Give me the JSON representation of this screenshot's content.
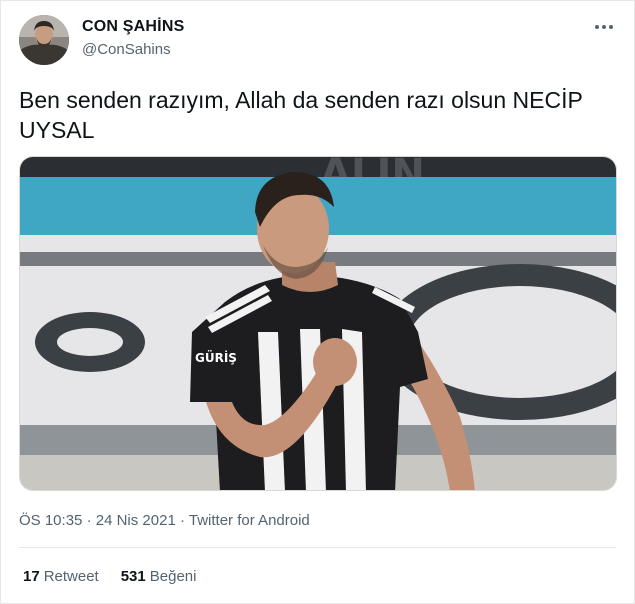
{
  "author": {
    "display_name": "CON ŞAHİNS",
    "handle": "@ConSahins"
  },
  "more_icon": "more-dots-icon",
  "tweet": {
    "text": "Ben senden razıyım, Allah da senden razı olsun NECİP UYSAL"
  },
  "media": {
    "jersey_sponsor": "GÜRİŞ",
    "banner_text": "ALIN"
  },
  "meta": {
    "time": "ÖS 10:35",
    "separator": "·",
    "date": "24 Nis 2021",
    "source": "Twitter for Android"
  },
  "stats": {
    "retweets_count": "17",
    "retweets_label": "Retweet",
    "likes_count": "531",
    "likes_label": "Beğeni"
  },
  "colors": {
    "text": "#0f1419",
    "secondary": "#536471",
    "border": "#e7e7e7"
  }
}
